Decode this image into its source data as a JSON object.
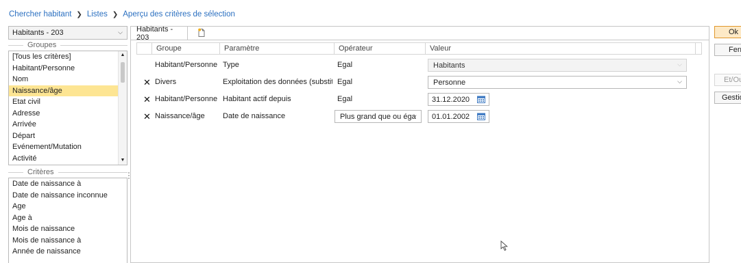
{
  "breadcrumb": [
    "Chercher habitant",
    "Listes",
    "Aperçu des critères de sélection"
  ],
  "left": {
    "selector": "Habitants - 203",
    "groups_title": "Groupes",
    "groups": [
      "[Tous les critères]",
      "Habitant/Personne",
      "Nom",
      "Naissance/âge",
      "Etat civil",
      "Adresse",
      "Arrivée",
      "Départ",
      "Evénement/Mutation",
      "Activité"
    ],
    "selected_group": "Naissance/âge",
    "criteria_title": "Critères",
    "criteria": [
      "Date de naissance à",
      "Date de naissance inconnue",
      "Age",
      "Age à",
      "Mois de naissance",
      "Mois de naissance à",
      "Année de naissance"
    ]
  },
  "main": {
    "tab": "Habitants - 203",
    "columns": [
      "Groupe",
      "Paramètre",
      "Opérateur",
      "Valeur"
    ],
    "rows": [
      {
        "deletable": false,
        "group": "Habitant/Personne",
        "param": "Type",
        "op": "Egal",
        "op_combo": false,
        "value": "Habitants",
        "value_kind": "combo-disabled"
      },
      {
        "deletable": true,
        "group": "Divers",
        "param": "Exploitation des données (substituti",
        "op": "Egal",
        "op_combo": false,
        "value": "Personne",
        "value_kind": "combo"
      },
      {
        "deletable": true,
        "group": "Habitant/Personne",
        "param": "Habitant actif depuis",
        "op": "Egal",
        "op_combo": false,
        "value": "31.12.2020",
        "value_kind": "date"
      },
      {
        "deletable": true,
        "group": "Naissance/âge",
        "param": "Date de naissance",
        "op": "Plus grand que ou éga",
        "op_combo": true,
        "value": "01.01.2002",
        "value_kind": "date"
      }
    ]
  },
  "right_buttons": [
    "Ok",
    "Ferme",
    "Et/Ou",
    "Gestio"
  ],
  "icons": {
    "breadcrumb_sep": "chevron-right-icon",
    "delete": "close-icon",
    "calendar": "calendar-icon",
    "new": "new-document-icon"
  },
  "colors": {
    "link": "#2a6fc0",
    "selected_row": "#fde593",
    "ok_button": "#fde9c6"
  }
}
